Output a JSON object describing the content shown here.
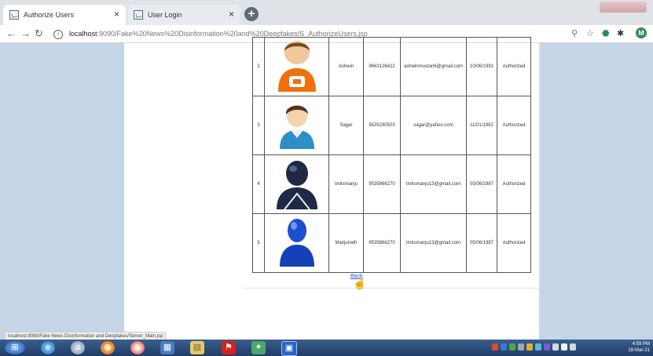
{
  "browser": {
    "tabs": [
      {
        "title": "Authorize Users",
        "active": true
      },
      {
        "title": "User Login",
        "active": false
      }
    ],
    "new_tab_label": "+",
    "url_host": "localhost",
    "url_path": ":9090/Fake%20News%20Disinformation%20and%20Deepfakes/S_AuthorizeUsers.jsp",
    "profile_initial": "M",
    "tab_close": "×"
  },
  "users": [
    {
      "num": "2",
      "name": "Ashwin",
      "mobile": "9663126422",
      "email": "ashwinmustan6@gmail.com",
      "dob": "10/06/1991",
      "status": "Authorized",
      "avatar_icon": "orange-shirt-user-icon"
    },
    {
      "num": "3",
      "name": "Sagar",
      "mobile": "9535290503",
      "email": "sagar@yahoo.com",
      "dob": "11/01/1992",
      "status": "Authorized",
      "avatar_icon": "blue-shirt-user-icon"
    },
    {
      "num": "4",
      "name": "tmksmanju",
      "mobile": "9535866270",
      "email": "tmksmanju13@gmail.com",
      "dob": "05/06/1987",
      "status": "Authorized",
      "avatar_icon": "dark-silhouette-user-icon"
    },
    {
      "num": "5",
      "name": "Manjunath",
      "mobile": "9535866270",
      "email": "tmksmanju13@gmail.com",
      "dob": "05/06/1987",
      "status": "Authorized",
      "avatar_icon": "blue-silhouette-user-icon"
    }
  ],
  "back_link": "Back",
  "status_url": "localhost:9090/Fake News Disinformation and Deepfakes/Server_Main.jsp",
  "clock": {
    "time": "4:59 PM",
    "date": "18-Mar-21"
  },
  "colors": {
    "page_bg": "#c5d5e8",
    "link": "#2a4de0",
    "taskbar": "#203d66"
  }
}
